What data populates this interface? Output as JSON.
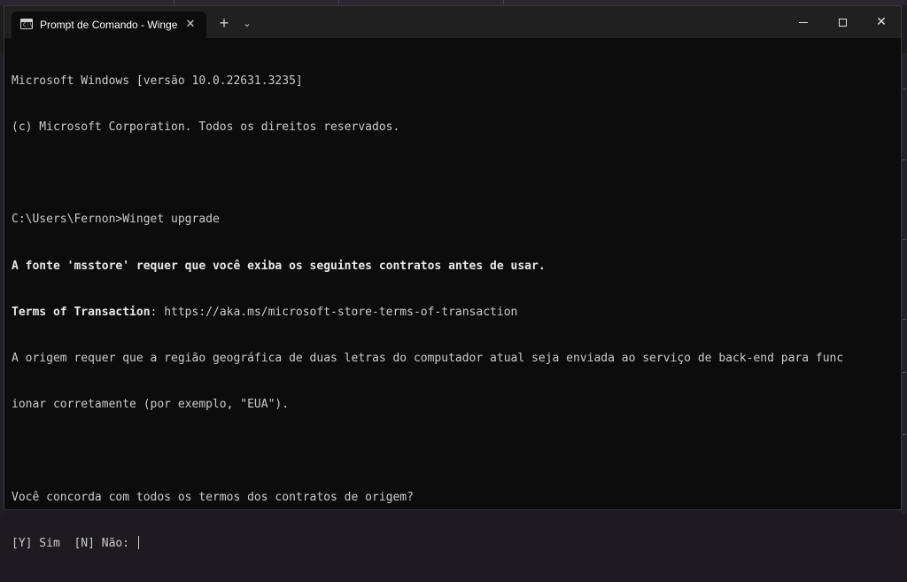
{
  "window": {
    "tab_title": "Prompt de Comando - Winge",
    "tab_close": "✕",
    "new_tab": "+",
    "dropdown": "⌄",
    "close_glyph": "✕"
  },
  "terminal": {
    "lines": [
      {
        "text": "Microsoft Windows [versão 10.0.22631.3235]"
      },
      {
        "text": "(c) Microsoft Corporation. Todos os direitos reservados."
      },
      {
        "text": ""
      },
      {
        "text": "C:\\Users\\Fernon>Winget upgrade"
      },
      {
        "text": "A fonte 'msstore' requer que você exiba os seguintes contratos antes de usar."
      },
      {
        "label": "Terms of Transaction",
        "rest": ": https://aka.ms/microsoft-store-terms-of-transaction"
      },
      {
        "text": "A origem requer que a região geográfica de duas letras do computador atual seja enviada ao serviço de back-end para func"
      },
      {
        "text": "ionar corretamente (por exemplo, \"EUA\")."
      },
      {
        "text": ""
      },
      {
        "text": "Você concorda com todos os termos dos contratos de origem?"
      },
      {
        "text": "[Y] Sim  [N] Não: "
      }
    ]
  }
}
